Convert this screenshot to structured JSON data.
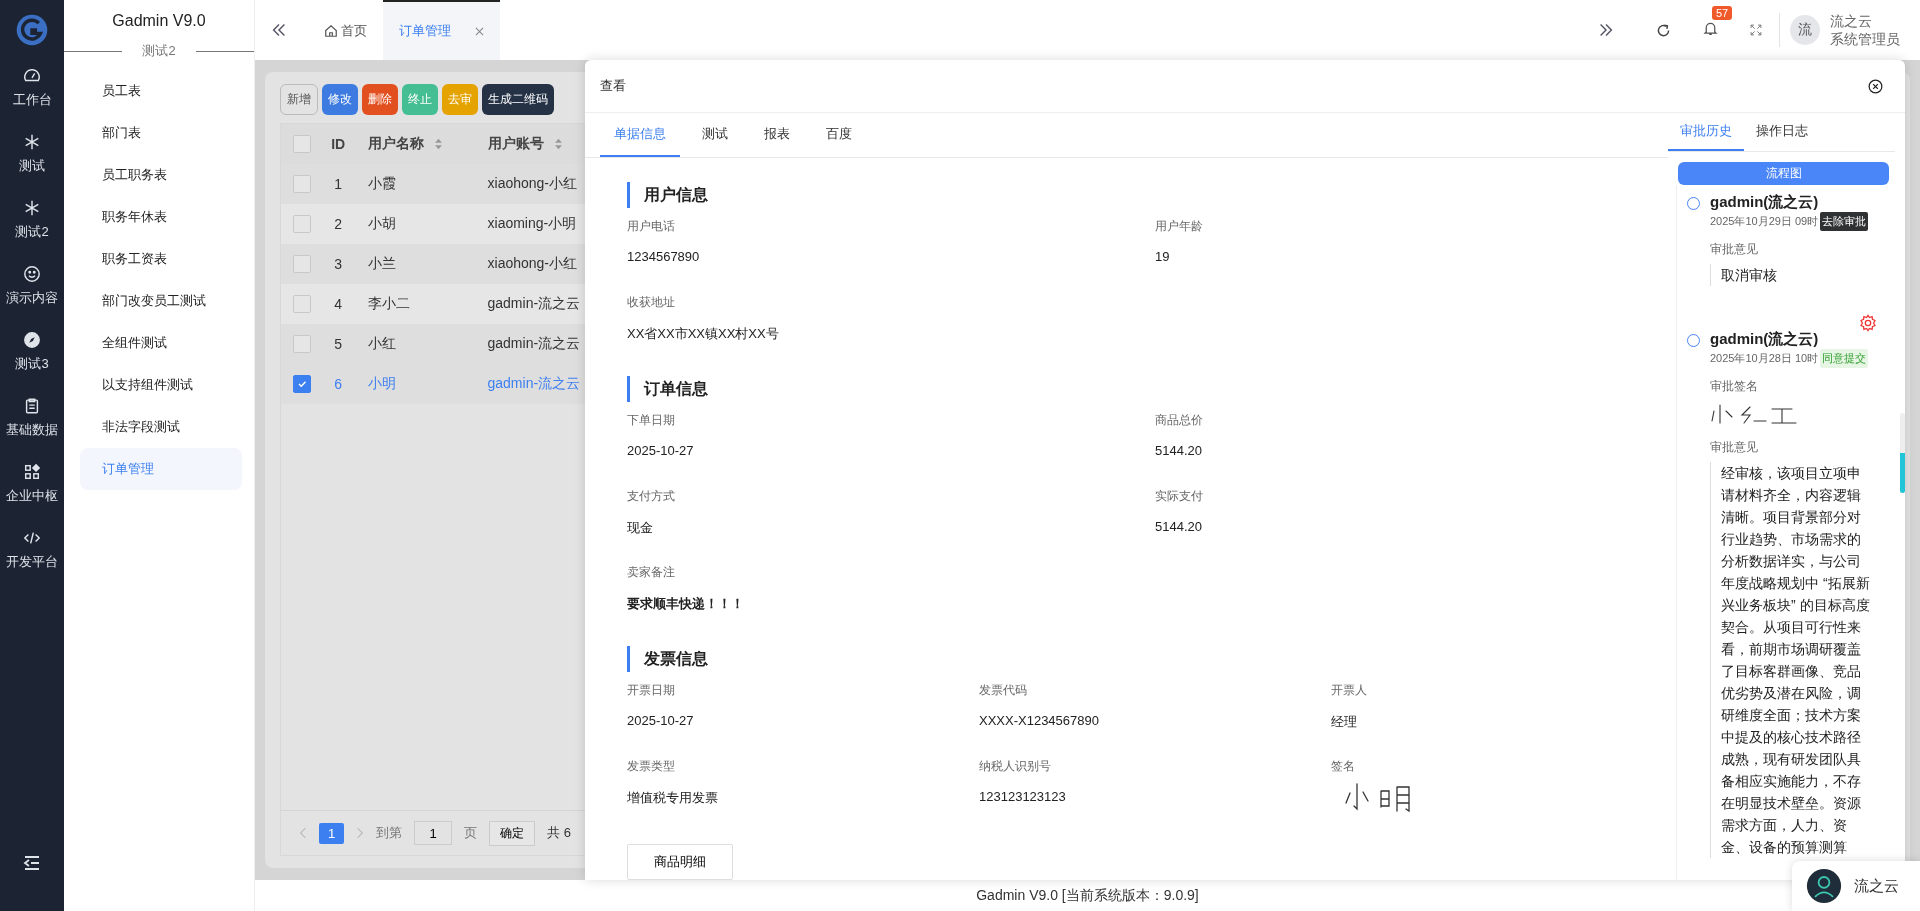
{
  "rail": {
    "items": [
      {
        "label": "工作台"
      },
      {
        "label": "测试"
      },
      {
        "label": "测试2"
      },
      {
        "label": "演示内容"
      },
      {
        "label": "测试3"
      },
      {
        "label": "基础数据"
      },
      {
        "label": "企业中枢"
      },
      {
        "label": "开发平台"
      }
    ]
  },
  "submenu": {
    "title": "Gadmin V9.0",
    "group": "测试2",
    "items": [
      {
        "label": "员工表",
        "selected": false
      },
      {
        "label": "部门表",
        "selected": false
      },
      {
        "label": "员工职务表",
        "selected": false
      },
      {
        "label": "职务年休表",
        "selected": false
      },
      {
        "label": "职务工资表",
        "selected": false
      },
      {
        "label": "部门改变员工测试",
        "selected": false
      },
      {
        "label": "全组件测试",
        "selected": false
      },
      {
        "label": "以支持组件测试",
        "selected": false
      },
      {
        "label": "非法字段测试",
        "selected": false
      },
      {
        "label": "订单管理",
        "selected": true
      }
    ]
  },
  "header": {
    "tabs": [
      {
        "label": "首页",
        "selected": false
      },
      {
        "label": "订单管理",
        "selected": true
      }
    ],
    "notifications": "57",
    "user": {
      "avatar": "流",
      "name": "流之云",
      "role": "系统管理员"
    }
  },
  "toolbar": [
    {
      "label": "新增",
      "color": "#e3e3e3"
    },
    {
      "label": "修改",
      "color": "#3d7be0"
    },
    {
      "label": "删除",
      "color": "#e2501f"
    },
    {
      "label": "终止",
      "color": "#46be94"
    },
    {
      "label": "去审",
      "color": "#e5a300"
    },
    {
      "label": "生成二维码",
      "color": "#253246"
    }
  ],
  "table": {
    "all_selected": false,
    "columns": [
      "ID",
      "用户名称",
      "用户账号"
    ],
    "rows": [
      {
        "id": "1",
        "name": "小霞",
        "account": "xiaohong-小红",
        "selected": false
      },
      {
        "id": "2",
        "name": "小胡",
        "account": "xiaoming-小明",
        "selected": false
      },
      {
        "id": "3",
        "name": "小兰",
        "account": "xiaohong-小红",
        "selected": false
      },
      {
        "id": "4",
        "name": "李小二",
        "account": "gadmin-流之云",
        "selected": false
      },
      {
        "id": "5",
        "name": "小红",
        "account": "gadmin-流之云",
        "selected": false
      },
      {
        "id": "6",
        "name": "小明",
        "account": "gadmin-流之云",
        "selected": true
      }
    ]
  },
  "pagination": {
    "page": "1",
    "goto_label": "到第",
    "goto_value": "1",
    "page_unit": "页",
    "confirm": "确定",
    "total": "共 6"
  },
  "dialog": {
    "title": "查看",
    "tabs": [
      {
        "label": "单据信息",
        "selected": true
      },
      {
        "label": "测试",
        "selected": false
      },
      {
        "label": "报表",
        "selected": false
      },
      {
        "label": "百度",
        "selected": false
      }
    ],
    "sections": [
      {
        "title": "用户信息",
        "kind": "two-column",
        "fields": [
          {
            "label": "用户电话",
            "value": "1234567890",
            "kind": "text"
          },
          {
            "label": "用户年龄",
            "value": "19",
            "kind": "text"
          },
          {
            "label": "收获地址",
            "value": "XX省XX市XX镇XX村XX号",
            "kind": "text"
          }
        ]
      },
      {
        "title": "订单信息",
        "kind": "two-column",
        "fields": [
          {
            "label": "下单日期",
            "value": "2025-10-27",
            "kind": "text"
          },
          {
            "label": "商品总价",
            "value": "5144.20",
            "kind": "text"
          },
          {
            "label": "支付方式",
            "value": "现金",
            "kind": "text"
          },
          {
            "label": "实际支付",
            "value": "5144.20",
            "kind": "text"
          },
          {
            "label": "卖家备注",
            "value": "要求顺丰快递！！！",
            "kind": "strong"
          }
        ]
      },
      {
        "title": "发票信息",
        "kind": "three-column",
        "fields": [
          {
            "label": "开票日期",
            "value": "2025-10-27",
            "kind": "text"
          },
          {
            "label": "发票代码",
            "value": "XXXX-X1234567890",
            "kind": "text"
          },
          {
            "label": "开票人",
            "value": "经理",
            "kind": "text"
          },
          {
            "label": "发票类型",
            "value": "增值税专用发票",
            "kind": "text"
          },
          {
            "label": "纳税人识别号",
            "value": "123123123123",
            "kind": "text"
          },
          {
            "label": "签名",
            "kind": "signature"
          }
        ]
      }
    ],
    "detail_button": "商品明细",
    "side_panel": {
      "tabs": [
        {
          "label": "审批历史",
          "selected": true
        },
        {
          "label": "操作日志",
          "selected": false
        }
      ],
      "flow_button": "流程图",
      "entries": [
        {
          "user": "gadmin(流之云)",
          "time": "2025年10月29日 09时",
          "tag": {
            "label": "去除审批",
            "kind": "dark"
          },
          "fields": [
            {
              "label": "审批意见",
              "kind": "comment",
              "value": "取消审核"
            }
          ]
        },
        {
          "user": "gadmin(流之云)",
          "time": "2025年10月28日 10时",
          "tag": {
            "label": "同意提交",
            "kind": "success"
          },
          "fields": [
            {
              "label": "审批签名",
              "kind": "signature"
            },
            {
              "label": "审批意见",
              "kind": "comment",
              "value": "经审核，该项目立项申请材料齐全，内容逻辑清晰。项目背景部分对行业趋势、市场需求的分析数据详实，与公司年度战略规划中 “拓展新兴业务板块” 的目标高度契合。从项目可行性来看，前期市场调研覆盖了目标客群画像、竞品优劣势及潜在风险，调研维度全面；技术方案中提及的核心技术路径成熟，现有研发团队具备相应实施能力，不存在明显技术壁垒。资源需求方面，人力、资金、设备的预算测算"
            }
          ]
        }
      ]
    }
  },
  "chat_widget": {
    "label": "流之云"
  },
  "footer": "Gadmin V9.0 [当前系统版本：9.0.9]"
}
